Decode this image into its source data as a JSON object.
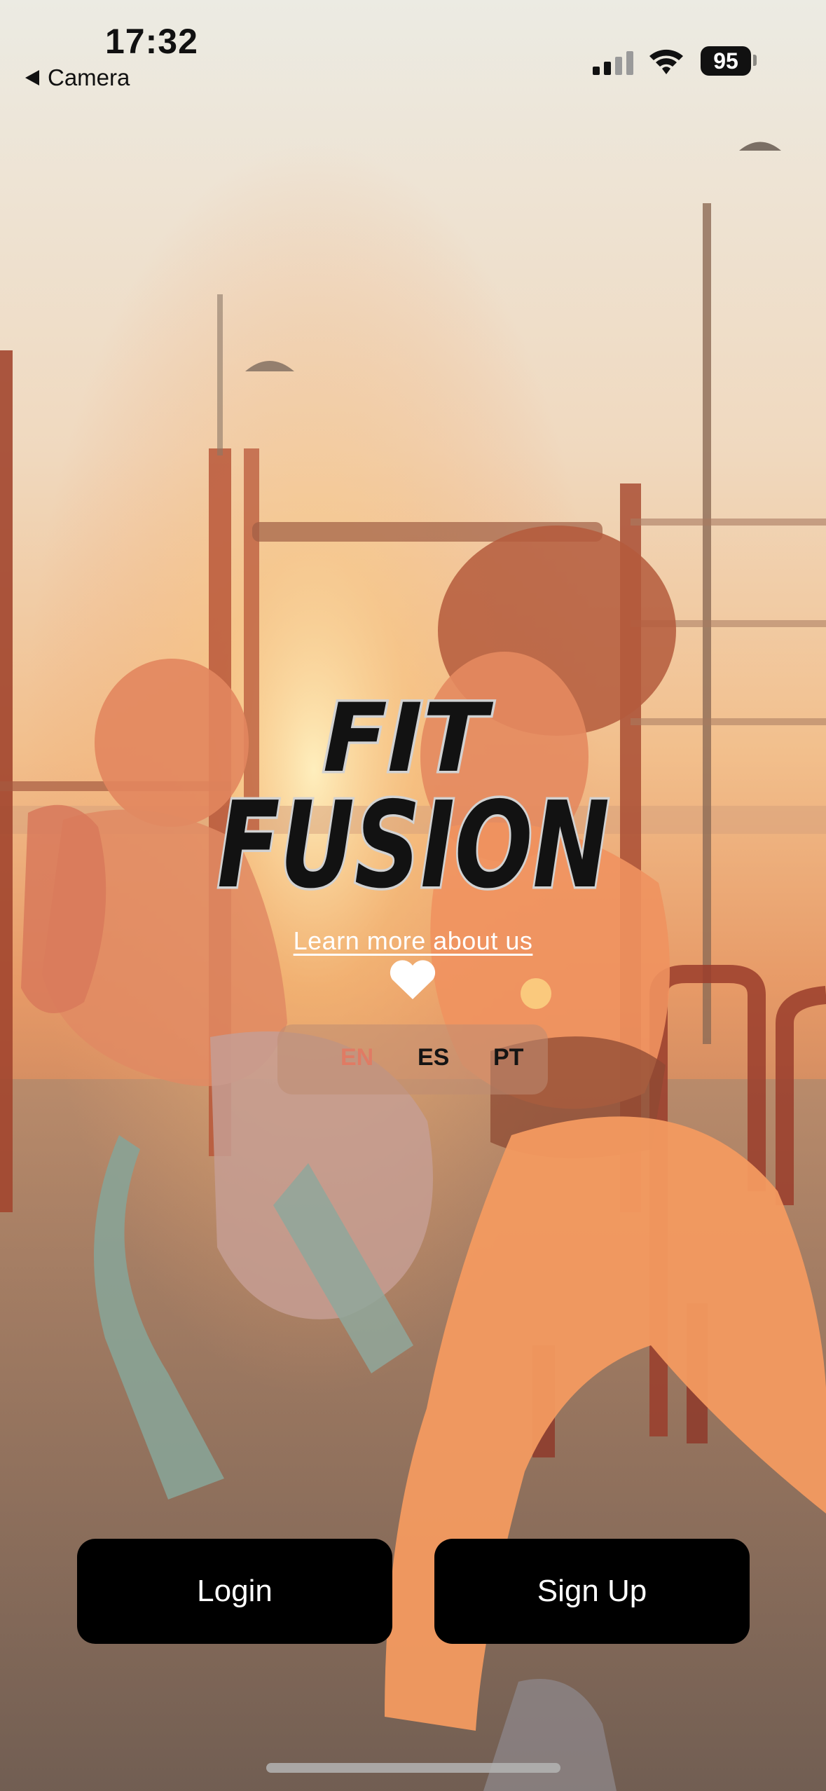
{
  "status_bar": {
    "time": "17:32",
    "back_label": "Camera",
    "battery": "95"
  },
  "logo": {
    "line1": "FIT",
    "line2": "FUSION"
  },
  "learn_more": "Learn more about us",
  "languages": {
    "items": [
      "EN",
      "ES",
      "PT"
    ],
    "selected": "EN",
    "selected_color": "#e07b64"
  },
  "actions": {
    "login": "Login",
    "signup": "Sign Up"
  },
  "icons": [
    "back-arrow-icon",
    "cellular-signal-icon",
    "wifi-icon",
    "battery-icon",
    "heart-icon"
  ],
  "colors": {
    "button_bg": "#000000",
    "button_text": "#ffffff",
    "accent": "#e07b64"
  }
}
